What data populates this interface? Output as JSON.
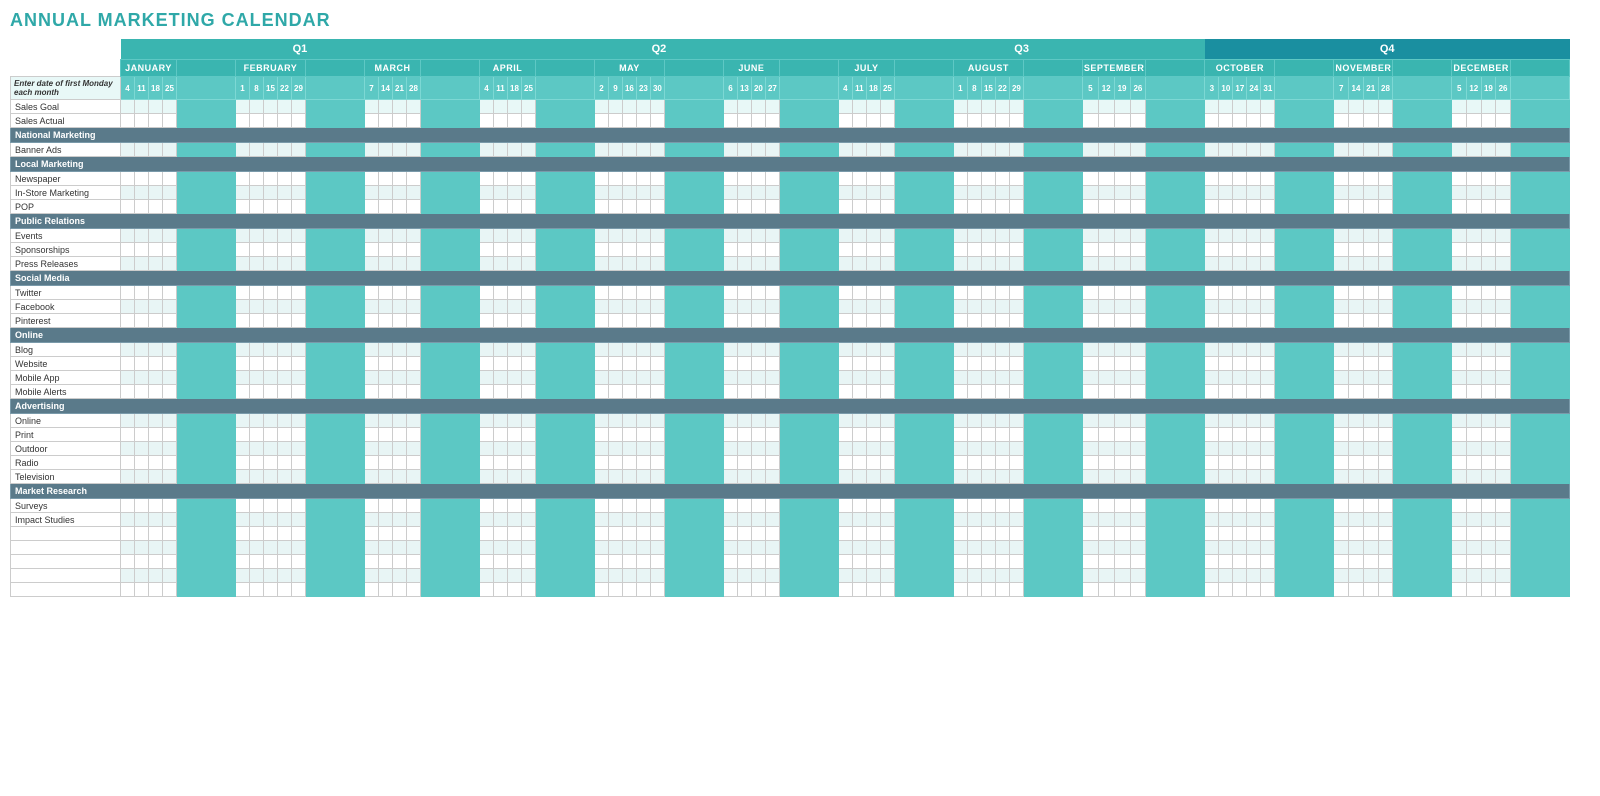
{
  "title": "ANNUAL MARKETING CALENDAR",
  "quarters": [
    {
      "label": "Q1",
      "span": 14,
      "class": "q1-bg"
    },
    {
      "label": "Q2",
      "span": 14,
      "class": "q2-bg"
    },
    {
      "label": "Q3",
      "span": 14,
      "class": "q3-bg"
    },
    {
      "label": "Q4",
      "span": 14,
      "class": "q4-bg"
    }
  ],
  "months": [
    {
      "label": "JANUARY",
      "days": [
        "4",
        "11",
        "18",
        "25"
      ]
    },
    {
      "label": "FEBRUARY",
      "days": [
        "1",
        "8",
        "15",
        "22",
        "29"
      ]
    },
    {
      "label": "MARCH",
      "days": [
        "7",
        "14",
        "21",
        "28"
      ]
    },
    {
      "label": "APRIL",
      "days": [
        "4",
        "11",
        "18",
        "25"
      ]
    },
    {
      "label": "MAY",
      "days": [
        "2",
        "9",
        "16",
        "23",
        "30"
      ]
    },
    {
      "label": "JUNE",
      "days": [
        "6",
        "13",
        "20",
        "27"
      ]
    },
    {
      "label": "JULY",
      "days": [
        "4",
        "11",
        "18",
        "25"
      ]
    },
    {
      "label": "AUGUST",
      "days": [
        "1",
        "8",
        "15",
        "22",
        "29"
      ]
    },
    {
      "label": "SEPTEMBER",
      "days": [
        "5",
        "12",
        "19",
        "26"
      ]
    },
    {
      "label": "OCTOBER",
      "days": [
        "3",
        "10",
        "17",
        "24",
        "31"
      ]
    },
    {
      "label": "NOVEMBER",
      "days": [
        "7",
        "14",
        "21",
        "28"
      ]
    },
    {
      "label": "DECEMBER",
      "days": [
        "5",
        "12",
        "19",
        "26"
      ]
    }
  ],
  "date_label": "Enter date of first Monday each month",
  "rows": [
    {
      "type": "data",
      "label": "Sales Goal",
      "class": "sales-goal"
    },
    {
      "type": "data",
      "label": "Sales Actual",
      "class": "sales-actual"
    },
    {
      "type": "section",
      "label": "National Marketing"
    },
    {
      "type": "data",
      "label": "Banner Ads",
      "alt": true
    },
    {
      "type": "section",
      "label": "Local Marketing"
    },
    {
      "type": "data",
      "label": "Newspaper",
      "alt": false
    },
    {
      "type": "data",
      "label": "In-Store Marketing",
      "alt": true
    },
    {
      "type": "data",
      "label": "POP",
      "alt": false
    },
    {
      "type": "section",
      "label": "Public Relations"
    },
    {
      "type": "data",
      "label": "Events",
      "alt": true
    },
    {
      "type": "data",
      "label": "Sponsorships",
      "alt": false
    },
    {
      "type": "data",
      "label": "Press Releases",
      "alt": true
    },
    {
      "type": "section",
      "label": "Social Media"
    },
    {
      "type": "data",
      "label": "Twitter",
      "alt": false
    },
    {
      "type": "data",
      "label": "Facebook",
      "alt": true
    },
    {
      "type": "data",
      "label": "Pinterest",
      "alt": false
    },
    {
      "type": "section",
      "label": "Online"
    },
    {
      "type": "data",
      "label": "Blog",
      "alt": true
    },
    {
      "type": "data",
      "label": "Website",
      "alt": false
    },
    {
      "type": "data",
      "label": "Mobile App",
      "alt": true
    },
    {
      "type": "data",
      "label": "Mobile Alerts",
      "alt": false
    },
    {
      "type": "section",
      "label": "Advertising"
    },
    {
      "type": "data",
      "label": "Online",
      "alt": true
    },
    {
      "type": "data",
      "label": "Print",
      "alt": false
    },
    {
      "type": "data",
      "label": "Outdoor",
      "alt": true
    },
    {
      "type": "data",
      "label": "Radio",
      "alt": false
    },
    {
      "type": "data",
      "label": "Television",
      "alt": true
    },
    {
      "type": "section",
      "label": "Market Research"
    },
    {
      "type": "data",
      "label": "Surveys",
      "alt": false
    },
    {
      "type": "data",
      "label": "Impact Studies",
      "alt": true
    },
    {
      "type": "data",
      "label": "",
      "alt": false
    },
    {
      "type": "data",
      "label": "",
      "alt": true
    },
    {
      "type": "data",
      "label": "",
      "alt": false
    },
    {
      "type": "data",
      "label": "",
      "alt": true
    },
    {
      "type": "data",
      "label": "",
      "alt": false
    }
  ]
}
